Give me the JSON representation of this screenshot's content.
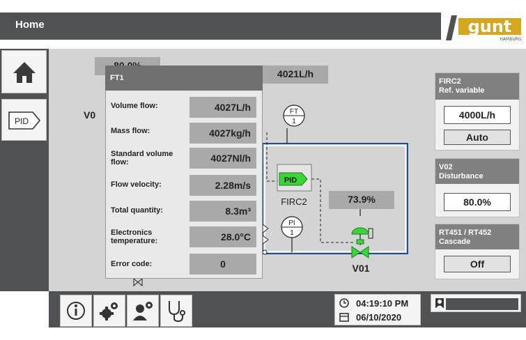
{
  "header": {
    "title": "Home"
  },
  "logo": {
    "brand": "gunt",
    "sub": "HAMBURG"
  },
  "sidenav": {
    "pid_label": "PID"
  },
  "process": {
    "top_left_value": "80.0%",
    "flow_value": "4021L/h",
    "v0_label": "V0",
    "ft_label": "FT",
    "ft_num": "1",
    "pid_label": "PID",
    "firc_label": "FIRC2",
    "valve_value": "73.9%",
    "pi_label": "PI",
    "pi_num": "1",
    "v01_label": "V01"
  },
  "panels": {
    "firc2": {
      "title_line1": "FIRC2",
      "title_line2": "Ref. variable",
      "value": "4000L/h",
      "mode": "Auto"
    },
    "v02": {
      "title_line1": "V02",
      "title_line2": "Disturbance",
      "value": "80.0%"
    },
    "rt": {
      "title_line1": "RT451 / RT452",
      "title_line2": "Cascade",
      "state": "Off"
    }
  },
  "popup": {
    "title": "FT1",
    "rows": [
      {
        "label": "Volume flow:",
        "value": "4027L/h"
      },
      {
        "label": "Mass flow:",
        "value": "4027kg/h"
      },
      {
        "label": "Standard volume flow:",
        "value": "4027Nl/h"
      },
      {
        "label": "Flow velocity:",
        "value": "2.28m/s"
      },
      {
        "label": "Total quantity:",
        "value": "8.3m³"
      },
      {
        "label": "Electronics temperature:",
        "value": "28.0°C"
      },
      {
        "label": "Error code:",
        "value": "0"
      }
    ]
  },
  "footer": {
    "time": "04:19:10 PM",
    "date": "06/10/2020"
  },
  "colors": {
    "dark": "#4f5153",
    "panel_head": "#808080",
    "pid_green": "#34d934",
    "pipe": "#1f4f8f"
  }
}
